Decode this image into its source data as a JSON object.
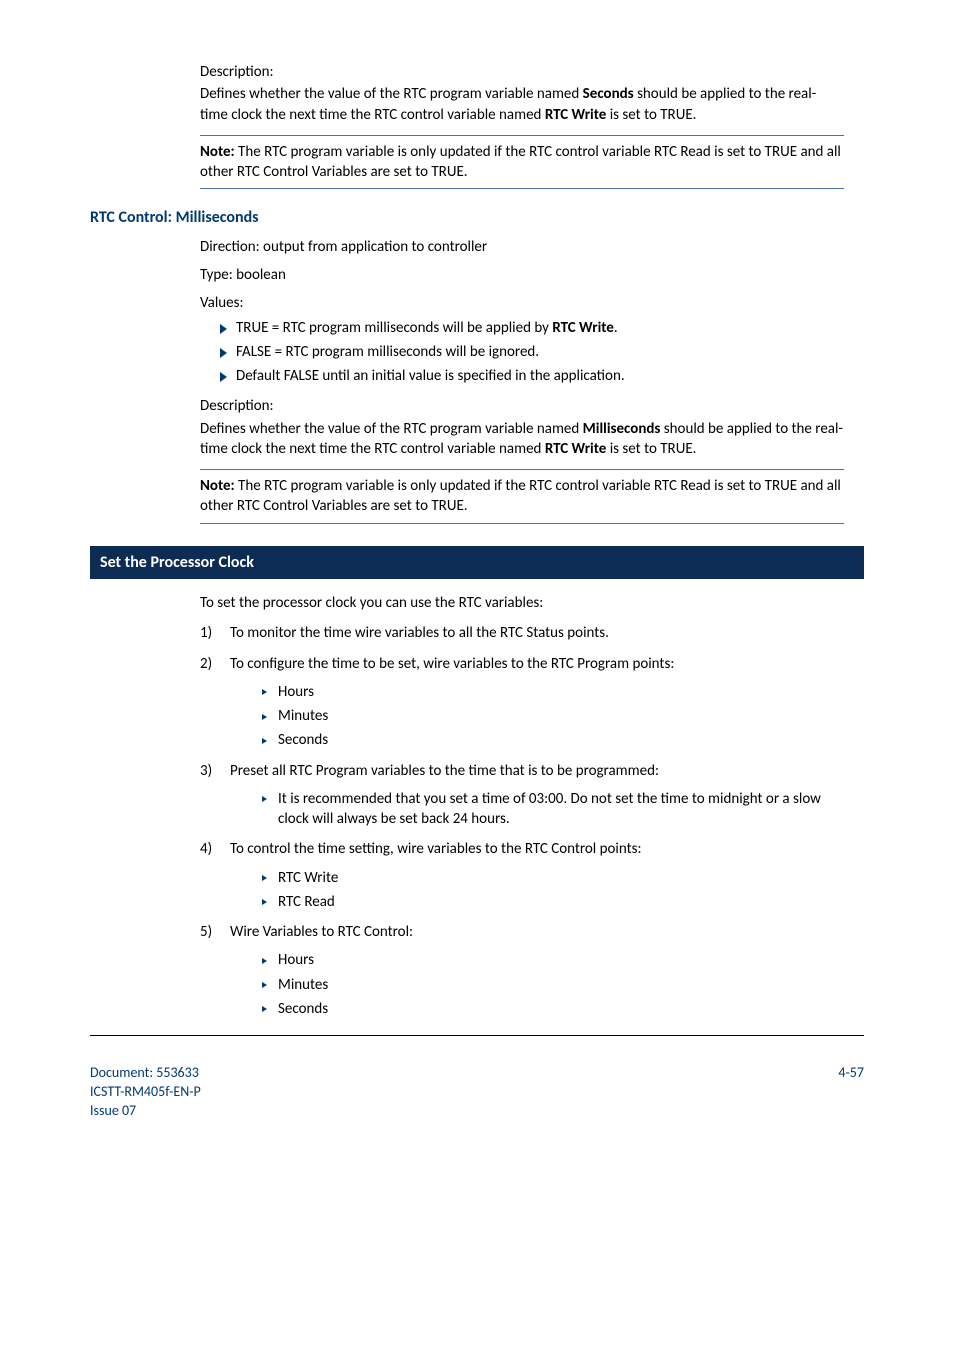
{
  "sec_prev": {
    "desc_label": "Description:",
    "desc_body_a": "Defines whether the value of the RTC program variable named ",
    "desc_body_b": " should be applied to the real-time clock the next time the RTC control variable named ",
    "desc_body_c": " is set to TRUE.",
    "var_name": "Seconds",
    "ctrl_name": "RTC Write",
    "note_label": "Note:",
    "note_body": " The RTC program variable is only updated if the RTC control variable RTC Read is set to TRUE and all other RTC Control Variables are set to TRUE."
  },
  "ms": {
    "heading": "RTC Control: Milliseconds",
    "direction": "Direction: output from application to controller",
    "type": "Type: boolean",
    "values_label": "Values:",
    "val1_a": "TRUE = RTC program milliseconds will be applied by ",
    "val1_b": "RTC Write",
    "val1_c": ".",
    "val2": "FALSE = RTC program milliseconds will be ignored.",
    "val3": "Default FALSE until an initial value is specified in the application.",
    "desc_label": "Description:",
    "desc_body_a": "Defines whether the value of the RTC program variable named ",
    "desc_body_b": " should be applied to the real-time clock the next time the RTC control variable named ",
    "desc_body_c": " is set to TRUE.",
    "var_name": "Milliseconds",
    "ctrl_name": "RTC Write",
    "note_label": "Note:",
    "note_body": " The RTC program variable is only updated if the RTC control variable RTC Read is set to TRUE and all other RTC Control Variables are set to TRUE."
  },
  "setproc": {
    "heading": "Set the Processor Clock",
    "intro": "To set the processor clock you can use the RTC variables:",
    "step1_num": "1)",
    "step1": "To monitor the time wire variables to all the RTC Status points.",
    "step2_num": "2)",
    "step2": "To configure the time to be set, wire variables to the RTC Program points:",
    "step2_items": {
      "a": "Hours",
      "b": "Minutes",
      "c": "Seconds"
    },
    "step3_num": "3)",
    "step3": "Preset all RTC Program variables to the time that is to be programmed:",
    "step3_items": {
      "a": "It is recommended that you set a time of 03:00. Do not set the time to midnight or a slow clock will always be set back 24 hours."
    },
    "step4_num": "4)",
    "step4": "To control the time setting, wire variables to the RTC Control points:",
    "step4_items": {
      "a": "RTC Write",
      "b": "RTC Read"
    },
    "step5_num": "5)",
    "step5": "Wire Variables to RTC Control:",
    "step5_items": {
      "a": "Hours",
      "b": "Minutes",
      "c": "Seconds"
    }
  },
  "footer": {
    "doc_line1": "Document: 553633",
    "doc_line2": "ICSTT-RM405f-EN-P",
    "doc_line3": "Issue 07",
    "page": "4-57"
  }
}
